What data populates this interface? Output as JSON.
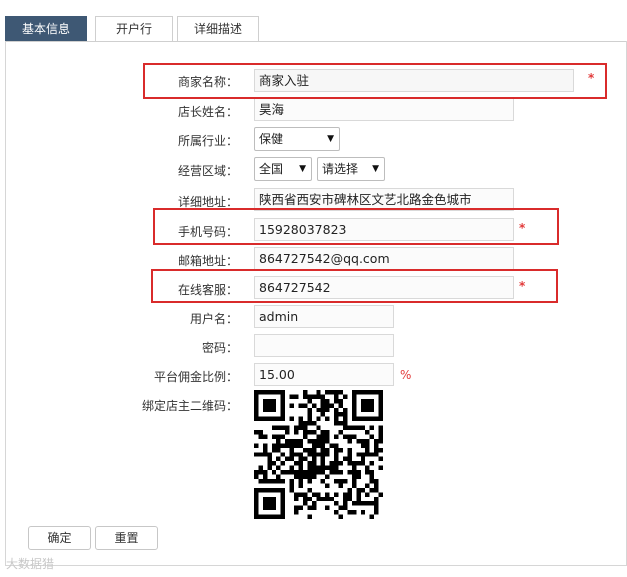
{
  "tabs": [
    {
      "label": "基本信息",
      "active": true
    },
    {
      "label": "开户行",
      "active": false
    },
    {
      "label": "详细描述",
      "active": false
    }
  ],
  "form": {
    "shop_name": {
      "label": "商家名称：",
      "value": "商家入驻",
      "required": "*"
    },
    "owner_name": {
      "label": "店长姓名：",
      "value": "昊海"
    },
    "industry": {
      "label": "所属行业：",
      "selected": "保健"
    },
    "region": {
      "label": "经营区域：",
      "selected_1": "全国",
      "selected_2": "请选择"
    },
    "address": {
      "label": "详细地址：",
      "value": "陕西省西安市碑林区文艺北路金色城市"
    },
    "phone": {
      "label": "手机号码：",
      "value": "15928037823",
      "required": "*"
    },
    "email": {
      "label": "邮箱地址：",
      "value": "864727542@qq.com"
    },
    "service": {
      "label": "在线客服：",
      "value": "864727542",
      "required": "*"
    },
    "username": {
      "label": "用户名：",
      "value": "admin"
    },
    "password": {
      "label": "密码：",
      "value": ""
    },
    "commission": {
      "label": "平台佣金比例：",
      "value": "15.00",
      "unit": "%"
    },
    "qrcode": {
      "label": "绑定店主二维码："
    }
  },
  "buttons": {
    "confirm": "确定",
    "reset": "重置"
  },
  "watermark": "大数据猎",
  "colors": {
    "active_tab": "#3e5874",
    "highlight": "#d92b2b",
    "required": "#e23b3b"
  },
  "icons": {
    "caret": "caret-down-icon",
    "qrcode": "qr-code-icon"
  }
}
